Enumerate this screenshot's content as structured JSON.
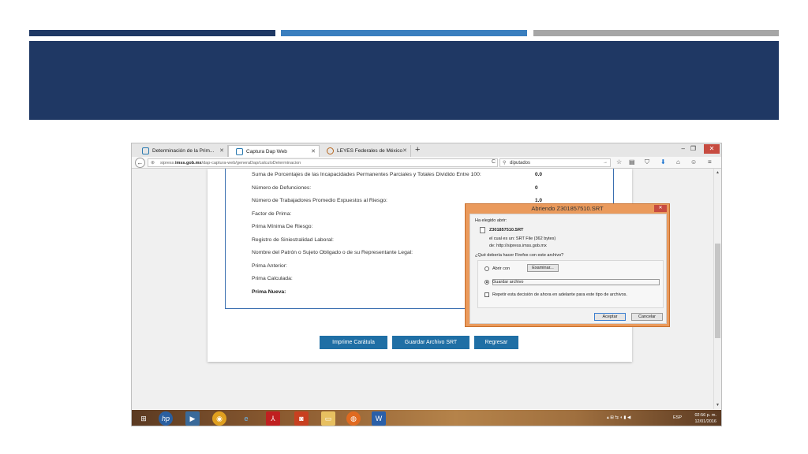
{
  "browser": {
    "tabs": [
      {
        "label": "Determinación de la Prim..."
      },
      {
        "label": "Captura Dap Web"
      },
      {
        "label": "LEYES Federales de México"
      }
    ],
    "new_tab": "+",
    "url_prefix": "sipress.",
    "url_host": "imss.gob.mx",
    "url_path": "/dap-captura-web/generaDap/calculoDeterminacion",
    "search_value": "diputados"
  },
  "form": {
    "rows": [
      {
        "label": "Suma de Porcentajes de las Incapacidades Permanentes Parciales y Totales Dividido Entre 100:",
        "value": "0.0"
      },
      {
        "label": "Número de Defunciones:",
        "value": "0"
      },
      {
        "label": "Número de Trabajadores Promedio Expuestos al Riesgo:",
        "value": "1.0"
      },
      {
        "label": "Factor de Prima:",
        "value": ""
      },
      {
        "label": "Prima Mínima De Riesgo:",
        "value": ""
      },
      {
        "label": "Registro de Siniestralidad Laboral:",
        "value": ""
      },
      {
        "label": "Nombre del Patrón o Sujeto Obligado o de su Representante Legal:",
        "value": ""
      },
      {
        "label": "Prima Anterior:",
        "value": ""
      },
      {
        "label": "Prima Calculada:",
        "value": ""
      },
      {
        "label": "Prima Nueva:",
        "value": ""
      }
    ],
    "buttons": {
      "print": "Imprime Carátula",
      "save": "Guardar Archivo SRT",
      "back": "Regresar"
    }
  },
  "dialog": {
    "title": "Abriendo Z301857510.SRT",
    "chosen": "Ha elegido abrir:",
    "filename": "Z301857510.SRT",
    "type_line": "el cual es un: SRT File (362 bytes)",
    "from_line": "de: http://sipress.imss.gob.mx",
    "question": "¿Qué debería hacer Firefox con este archivo?",
    "open_with": "Abrir con",
    "browse": "Examinar...",
    "save_file": "Guardar archivo",
    "remember": "Repetir esta decisión de ahora en adelante para este tipo de archivos.",
    "accept": "Aceptar",
    "cancel": "Cancelar"
  },
  "taskbar": {
    "lang": "ESP",
    "time": "02:56 p. m.",
    "date": "12/01/2016"
  },
  "colors": {
    "header_dark": "#1f3864",
    "accent_blue": "#3a7fbf",
    "accent_gray": "#a6a6a6",
    "button_blue": "#1f6fa5",
    "dialog_orange": "#ea9a5c"
  }
}
